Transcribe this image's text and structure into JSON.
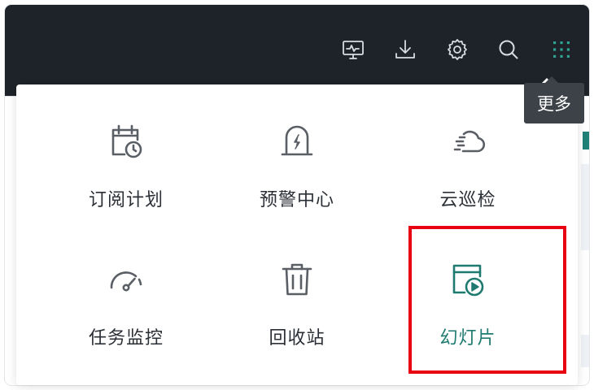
{
  "colors": {
    "topbar_bg": "#1e2329",
    "icon_gray": "#5a5f66",
    "accent_teal": "#1f7a70",
    "highlight_red": "#e60012",
    "tooltip_bg": "#3d4248"
  },
  "toolbar": {
    "icons": [
      "monitor-pulse-icon",
      "download-icon",
      "gear-icon",
      "search-icon",
      "grid-apps-icon"
    ]
  },
  "tooltip": {
    "text": "更多"
  },
  "menu": {
    "items": [
      {
        "label": "订阅计划",
        "icon": "calendar-clock-icon"
      },
      {
        "label": "预警中心",
        "icon": "alarm-bell-icon"
      },
      {
        "label": "云巡检",
        "icon": "cloud-speed-icon"
      },
      {
        "label": "任务监控",
        "icon": "gauge-icon"
      },
      {
        "label": "回收站",
        "icon": "trash-icon"
      },
      {
        "label": "幻灯片",
        "icon": "slideshow-play-icon"
      }
    ],
    "active_index": 5
  }
}
